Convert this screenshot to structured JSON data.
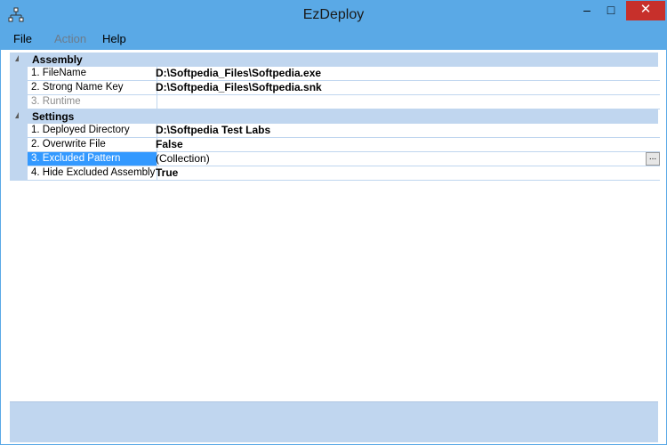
{
  "window": {
    "title": "EzDeploy",
    "min_glyph": "–",
    "max_glyph": "□",
    "close_glyph": "✕"
  },
  "menu": {
    "file": "File",
    "action": "Action",
    "help": "Help"
  },
  "grid": {
    "categories": [
      {
        "label": "Assembly",
        "properties": [
          {
            "name": "1. FileName",
            "value": "D:\\Softpedia_Files\\Softpedia.exe"
          },
          {
            "name": "2. Strong Name Key",
            "value": "D:\\Softpedia_Files\\Softpedia.snk"
          },
          {
            "name": "3. Runtime",
            "value": ""
          }
        ]
      },
      {
        "label": "Settings",
        "properties": [
          {
            "name": "1. Deployed Directory",
            "value": "D:\\Softpedia Test Labs"
          },
          {
            "name": "2. Overwrite File",
            "value": "False"
          },
          {
            "name": "3. Excluded Pattern",
            "value": "(Collection)",
            "button": "..."
          },
          {
            "name": "4. Hide Excluded Assembly",
            "value": "True"
          }
        ]
      }
    ]
  },
  "colors": {
    "titlebar": "#5aa9e6",
    "close_button": "#c7302b",
    "category_band": "#c0d6ef",
    "selection": "#3399ff"
  }
}
